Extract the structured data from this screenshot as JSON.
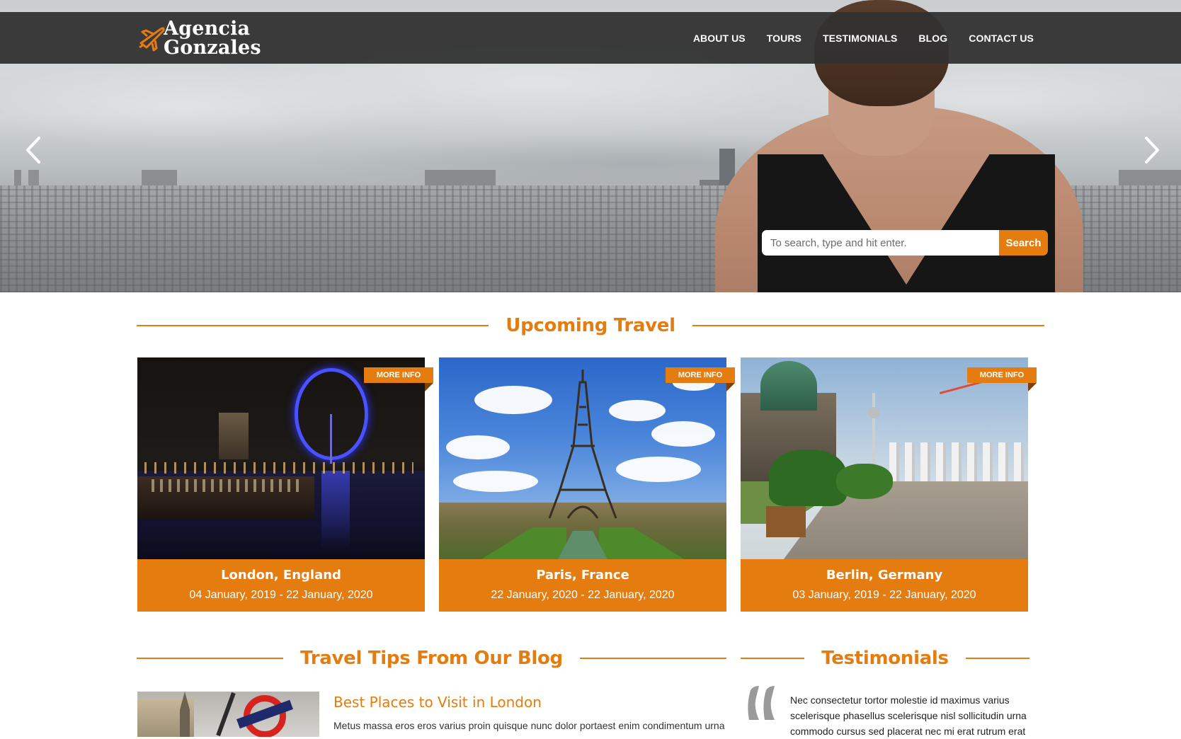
{
  "brand": {
    "name_line1": "Agencia",
    "name_line2": "Gonzales"
  },
  "nav": {
    "items": [
      "ABOUT US",
      "TOURS",
      "TESTIMONIALS",
      "BLOG",
      "CONTACT US"
    ]
  },
  "hero": {
    "prev_icon": "chevron-left-icon",
    "next_icon": "chevron-right-icon"
  },
  "search": {
    "placeholder": "To search, type and hit enter.",
    "button_label": "Search"
  },
  "upcoming": {
    "heading": "Upcoming Travel",
    "more_info_label": "MORE INFO",
    "cards": [
      {
        "city": "London, England",
        "dates": "04 January, 2019 - 22 January, 2020"
      },
      {
        "city": "Paris, France",
        "dates": "22 January, 2020 - 22 January, 2020"
      },
      {
        "city": "Berlin, Germany",
        "dates": "03 January, 2019 - 22 January, 2020"
      }
    ]
  },
  "blog": {
    "heading": "Travel Tips From Our Blog",
    "post_title": "Best Places to Visit in London",
    "post_excerpt": "Metus massa eros eros varius proin quisque nunc dolor portaest enim condimentum urna"
  },
  "testimonials": {
    "heading": "Testimonials",
    "quote_line1": "Nec consectetur tortor molestie id maximus varius",
    "quote_line2": "scelerisque phasellus scelerisque nisl sollicitudin urna",
    "quote_line3": "commodo cursus sed placerat nec mi erat rutrum erat"
  },
  "colors": {
    "accent": "#e47c0f",
    "navbar": "#323232",
    "text": "#333333"
  }
}
